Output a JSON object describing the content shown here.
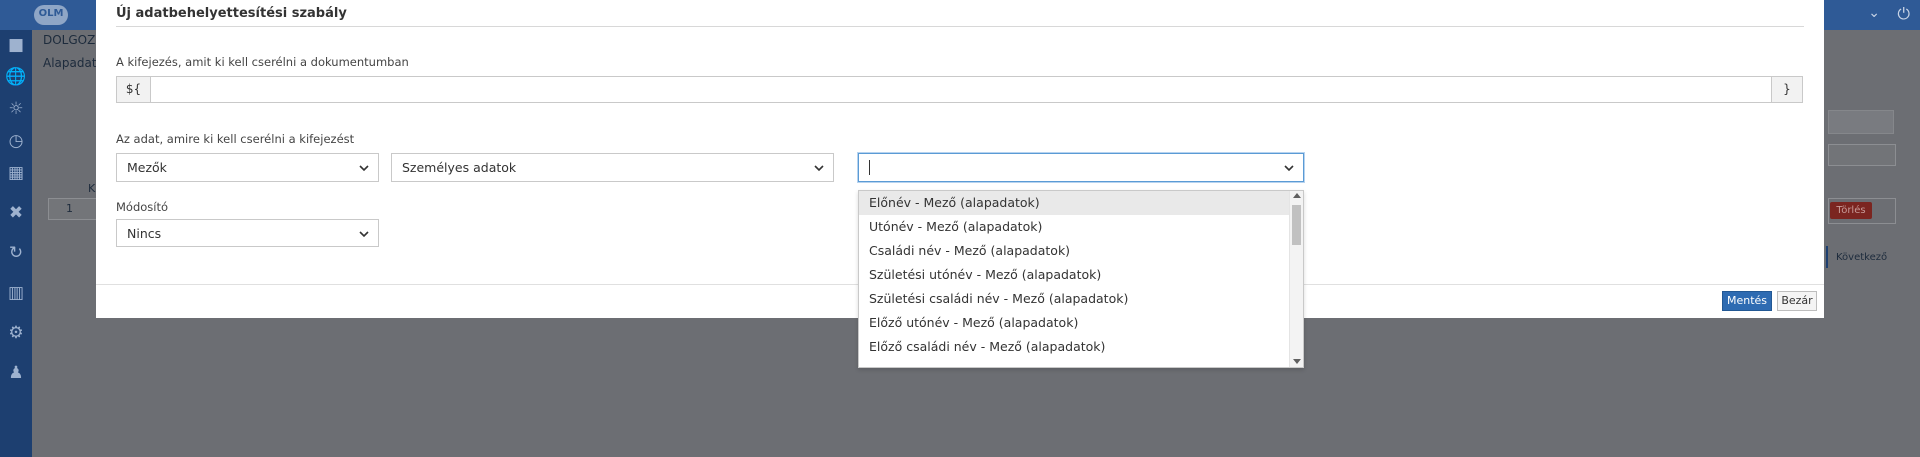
{
  "app": {
    "logo_text": "OLM"
  },
  "background": {
    "title": "DOLGOZ",
    "subtitle": "Alapadat",
    "column_k": "K",
    "row_number": "1",
    "delete_button": "Törlés",
    "next_link": "Következő"
  },
  "modal": {
    "title": "Új adatbehelyettesítési szabály",
    "expression_label": "A kifejezés, amit ki kell cserélni a dokumentumban",
    "expression_prefix": "${",
    "expression_value": "",
    "expression_suffix": "}",
    "data_label": "Az adat, amire ki kell cserélni a kifejezést",
    "source_select": "Mezők",
    "group_select": "Személyes adatok",
    "field_select_value": "",
    "modifier_label": "Módosító",
    "modifier_select": "Nincs",
    "save_button": "Mentés",
    "close_button": "Bezár"
  },
  "dropdown": {
    "options": [
      "Előnév - Mező (alapadatok)",
      "Utónév - Mező (alapadatok)",
      "Családi név - Mező (alapadatok)",
      "Születési utónév - Mező (alapadatok)",
      "Születési családi név - Mező (alapadatok)",
      "Előző utónév - Mező (alapadatok)",
      "Előző családi név - Mező (alapadatok)"
    ],
    "highlighted_option": "Előnév - Mező (alapadatok)"
  },
  "colors": {
    "topbar": "#2f5a96",
    "sidebar": "#1d3f70",
    "primary_button": "#2e6bb2",
    "focus_border": "#5b9bd5"
  },
  "icons": [
    "globe-icon",
    "sun-icon",
    "dashboard-icon",
    "calendar-icon",
    "tools-icon",
    "transfer-icon",
    "chart-icon",
    "settings-icon",
    "users-icon",
    "chevron-down-icon",
    "power-icon"
  ]
}
